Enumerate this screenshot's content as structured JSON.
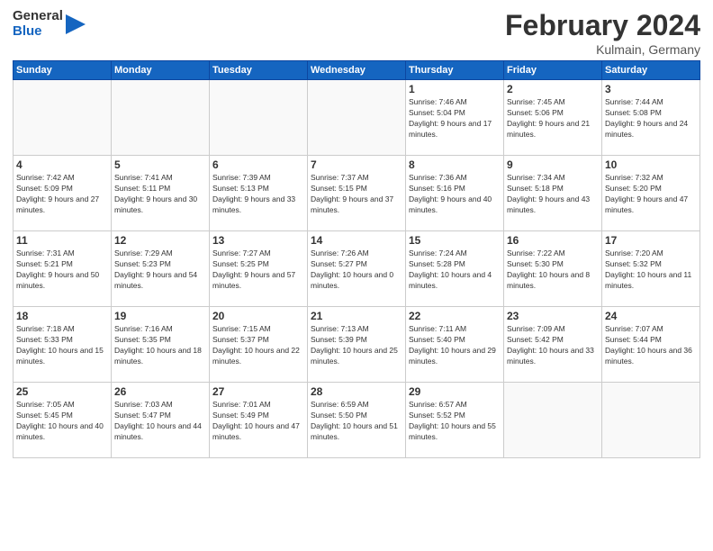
{
  "header": {
    "logo_line1": "General",
    "logo_line2": "Blue",
    "month_title": "February 2024",
    "location": "Kulmain, Germany"
  },
  "weekdays": [
    "Sunday",
    "Monday",
    "Tuesday",
    "Wednesday",
    "Thursday",
    "Friday",
    "Saturday"
  ],
  "weeks": [
    [
      {
        "day": "",
        "sunrise": "",
        "sunset": "",
        "daylight": ""
      },
      {
        "day": "",
        "sunrise": "",
        "sunset": "",
        "daylight": ""
      },
      {
        "day": "",
        "sunrise": "",
        "sunset": "",
        "daylight": ""
      },
      {
        "day": "",
        "sunrise": "",
        "sunset": "",
        "daylight": ""
      },
      {
        "day": "1",
        "sunrise": "Sunrise: 7:46 AM",
        "sunset": "Sunset: 5:04 PM",
        "daylight": "Daylight: 9 hours and 17 minutes."
      },
      {
        "day": "2",
        "sunrise": "Sunrise: 7:45 AM",
        "sunset": "Sunset: 5:06 PM",
        "daylight": "Daylight: 9 hours and 21 minutes."
      },
      {
        "day": "3",
        "sunrise": "Sunrise: 7:44 AM",
        "sunset": "Sunset: 5:08 PM",
        "daylight": "Daylight: 9 hours and 24 minutes."
      }
    ],
    [
      {
        "day": "4",
        "sunrise": "Sunrise: 7:42 AM",
        "sunset": "Sunset: 5:09 PM",
        "daylight": "Daylight: 9 hours and 27 minutes."
      },
      {
        "day": "5",
        "sunrise": "Sunrise: 7:41 AM",
        "sunset": "Sunset: 5:11 PM",
        "daylight": "Daylight: 9 hours and 30 minutes."
      },
      {
        "day": "6",
        "sunrise": "Sunrise: 7:39 AM",
        "sunset": "Sunset: 5:13 PM",
        "daylight": "Daylight: 9 hours and 33 minutes."
      },
      {
        "day": "7",
        "sunrise": "Sunrise: 7:37 AM",
        "sunset": "Sunset: 5:15 PM",
        "daylight": "Daylight: 9 hours and 37 minutes."
      },
      {
        "day": "8",
        "sunrise": "Sunrise: 7:36 AM",
        "sunset": "Sunset: 5:16 PM",
        "daylight": "Daylight: 9 hours and 40 minutes."
      },
      {
        "day": "9",
        "sunrise": "Sunrise: 7:34 AM",
        "sunset": "Sunset: 5:18 PM",
        "daylight": "Daylight: 9 hours and 43 minutes."
      },
      {
        "day": "10",
        "sunrise": "Sunrise: 7:32 AM",
        "sunset": "Sunset: 5:20 PM",
        "daylight": "Daylight: 9 hours and 47 minutes."
      }
    ],
    [
      {
        "day": "11",
        "sunrise": "Sunrise: 7:31 AM",
        "sunset": "Sunset: 5:21 PM",
        "daylight": "Daylight: 9 hours and 50 minutes."
      },
      {
        "day": "12",
        "sunrise": "Sunrise: 7:29 AM",
        "sunset": "Sunset: 5:23 PM",
        "daylight": "Daylight: 9 hours and 54 minutes."
      },
      {
        "day": "13",
        "sunrise": "Sunrise: 7:27 AM",
        "sunset": "Sunset: 5:25 PM",
        "daylight": "Daylight: 9 hours and 57 minutes."
      },
      {
        "day": "14",
        "sunrise": "Sunrise: 7:26 AM",
        "sunset": "Sunset: 5:27 PM",
        "daylight": "Daylight: 10 hours and 0 minutes."
      },
      {
        "day": "15",
        "sunrise": "Sunrise: 7:24 AM",
        "sunset": "Sunset: 5:28 PM",
        "daylight": "Daylight: 10 hours and 4 minutes."
      },
      {
        "day": "16",
        "sunrise": "Sunrise: 7:22 AM",
        "sunset": "Sunset: 5:30 PM",
        "daylight": "Daylight: 10 hours and 8 minutes."
      },
      {
        "day": "17",
        "sunrise": "Sunrise: 7:20 AM",
        "sunset": "Sunset: 5:32 PM",
        "daylight": "Daylight: 10 hours and 11 minutes."
      }
    ],
    [
      {
        "day": "18",
        "sunrise": "Sunrise: 7:18 AM",
        "sunset": "Sunset: 5:33 PM",
        "daylight": "Daylight: 10 hours and 15 minutes."
      },
      {
        "day": "19",
        "sunrise": "Sunrise: 7:16 AM",
        "sunset": "Sunset: 5:35 PM",
        "daylight": "Daylight: 10 hours and 18 minutes."
      },
      {
        "day": "20",
        "sunrise": "Sunrise: 7:15 AM",
        "sunset": "Sunset: 5:37 PM",
        "daylight": "Daylight: 10 hours and 22 minutes."
      },
      {
        "day": "21",
        "sunrise": "Sunrise: 7:13 AM",
        "sunset": "Sunset: 5:39 PM",
        "daylight": "Daylight: 10 hours and 25 minutes."
      },
      {
        "day": "22",
        "sunrise": "Sunrise: 7:11 AM",
        "sunset": "Sunset: 5:40 PM",
        "daylight": "Daylight: 10 hours and 29 minutes."
      },
      {
        "day": "23",
        "sunrise": "Sunrise: 7:09 AM",
        "sunset": "Sunset: 5:42 PM",
        "daylight": "Daylight: 10 hours and 33 minutes."
      },
      {
        "day": "24",
        "sunrise": "Sunrise: 7:07 AM",
        "sunset": "Sunset: 5:44 PM",
        "daylight": "Daylight: 10 hours and 36 minutes."
      }
    ],
    [
      {
        "day": "25",
        "sunrise": "Sunrise: 7:05 AM",
        "sunset": "Sunset: 5:45 PM",
        "daylight": "Daylight: 10 hours and 40 minutes."
      },
      {
        "day": "26",
        "sunrise": "Sunrise: 7:03 AM",
        "sunset": "Sunset: 5:47 PM",
        "daylight": "Daylight: 10 hours and 44 minutes."
      },
      {
        "day": "27",
        "sunrise": "Sunrise: 7:01 AM",
        "sunset": "Sunset: 5:49 PM",
        "daylight": "Daylight: 10 hours and 47 minutes."
      },
      {
        "day": "28",
        "sunrise": "Sunrise: 6:59 AM",
        "sunset": "Sunset: 5:50 PM",
        "daylight": "Daylight: 10 hours and 51 minutes."
      },
      {
        "day": "29",
        "sunrise": "Sunrise: 6:57 AM",
        "sunset": "Sunset: 5:52 PM",
        "daylight": "Daylight: 10 hours and 55 minutes."
      },
      {
        "day": "",
        "sunrise": "",
        "sunset": "",
        "daylight": ""
      },
      {
        "day": "",
        "sunrise": "",
        "sunset": "",
        "daylight": ""
      }
    ]
  ]
}
